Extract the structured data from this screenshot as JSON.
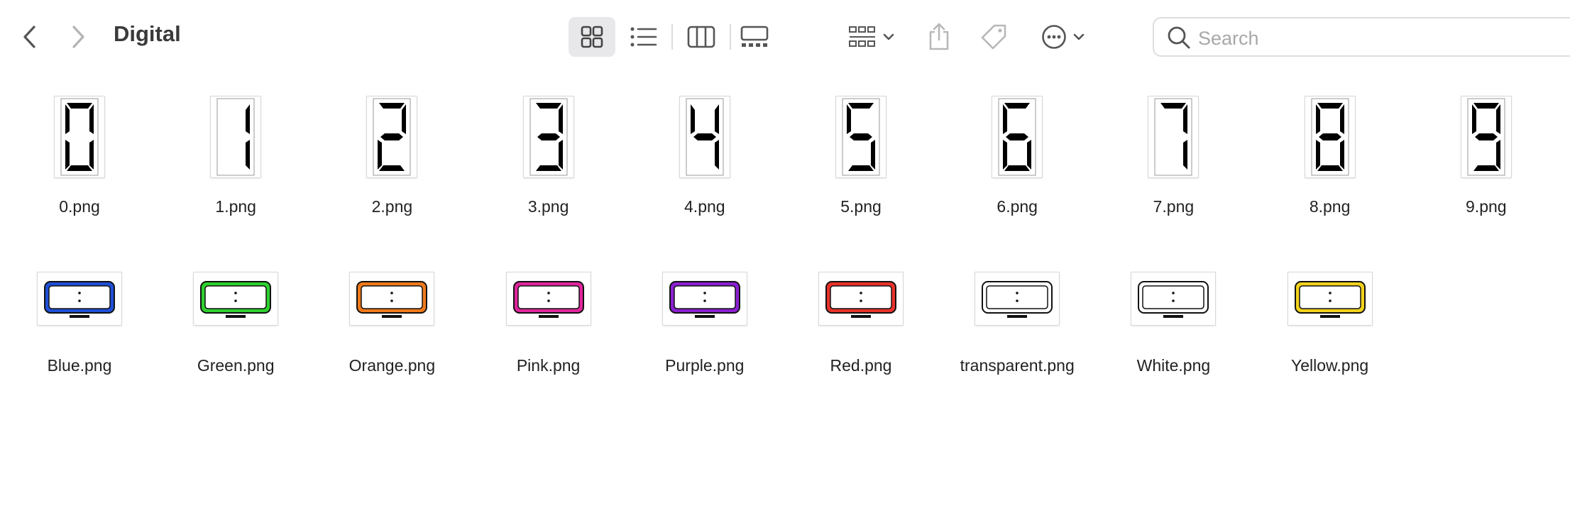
{
  "window": {
    "title": "Digital"
  },
  "toolbar": {
    "back_icon": "chevron-left-icon",
    "forward_icon": "chevron-right-icon",
    "view_modes": [
      "icon-view-icon",
      "list-view-icon",
      "column-view-icon",
      "gallery-view-icon"
    ],
    "active_view": "icon-view-icon",
    "group_icon": "group-by-icon",
    "share_icon": "share-icon",
    "tag_icon": "tag-icon",
    "more_icon": "more-actions-icon"
  },
  "search": {
    "placeholder": "Search"
  },
  "files": {
    "digits": [
      {
        "name": "0.png",
        "digit": "0"
      },
      {
        "name": "1.png",
        "digit": "1"
      },
      {
        "name": "2.png",
        "digit": "2"
      },
      {
        "name": "3.png",
        "digit": "3"
      },
      {
        "name": "4.png",
        "digit": "4"
      },
      {
        "name": "5.png",
        "digit": "5"
      },
      {
        "name": "6.png",
        "digit": "6"
      },
      {
        "name": "7.png",
        "digit": "7"
      },
      {
        "name": "8.png",
        "digit": "8"
      },
      {
        "name": "9.png",
        "digit": "9"
      }
    ],
    "clocks": [
      {
        "name": "Blue.png",
        "color": "#1f4fd6"
      },
      {
        "name": "Green.png",
        "color": "#2ed12e"
      },
      {
        "name": "Orange.png",
        "color": "#f07a1a"
      },
      {
        "name": "Pink.png",
        "color": "#e0259c"
      },
      {
        "name": "Purple.png",
        "color": "#8a1fd0"
      },
      {
        "name": "Red.png",
        "color": "#e8322a"
      },
      {
        "name": "transparent.png",
        "color": "#ffffff"
      },
      {
        "name": "White.png",
        "color": "#ffffff"
      },
      {
        "name": "Yellow.png",
        "color": "#f2d21c"
      }
    ]
  }
}
